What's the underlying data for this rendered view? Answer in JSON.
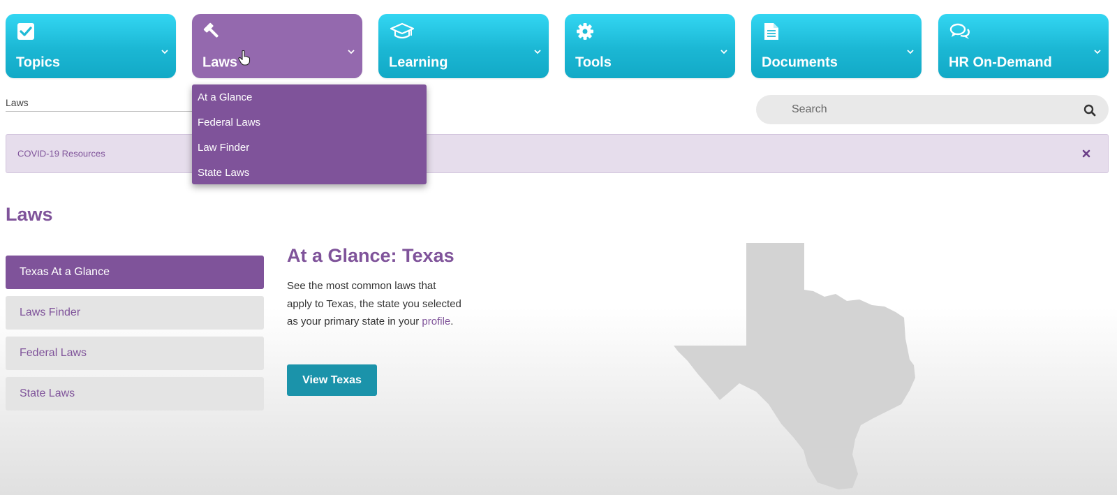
{
  "nav": {
    "tiles": [
      {
        "label": "Topics",
        "icon": "checkbox-icon"
      },
      {
        "label": "Laws",
        "icon": "gavel-icon",
        "active": true
      },
      {
        "label": "Learning",
        "icon": "graduation-cap-icon"
      },
      {
        "label": "Tools",
        "icon": "gear-icon"
      },
      {
        "label": "Documents",
        "icon": "document-icon"
      },
      {
        "label": "HR On-Demand",
        "icon": "chat-bubbles-icon"
      }
    ]
  },
  "dropdown": {
    "items": [
      "At a Glance",
      "Federal Laws",
      "Law Finder",
      "State Laws"
    ]
  },
  "breadcrumb": {
    "label": "Laws"
  },
  "search": {
    "placeholder": "Search",
    "value": ""
  },
  "alert": {
    "text": "COVID-19 Resources",
    "close_icon": "close-icon"
  },
  "page": {
    "title": "Laws"
  },
  "side_menu": {
    "items": [
      {
        "label": "Texas At a Glance",
        "active": true
      },
      {
        "label": "Laws Finder"
      },
      {
        "label": "Federal Laws"
      },
      {
        "label": "State Laws"
      }
    ]
  },
  "content": {
    "title": "At a Glance: Texas",
    "body_text": "See the most common laws that apply to Texas, the state you selected as your primary state in your ",
    "link_text": "profile",
    "body_end": ".",
    "button_label": "View Texas"
  },
  "colors": {
    "brand_purple": "#7f539a",
    "active_tile_purple": "#9469ae",
    "tile_cyan": "#1bb7d4",
    "button_teal": "#1b93aa"
  }
}
